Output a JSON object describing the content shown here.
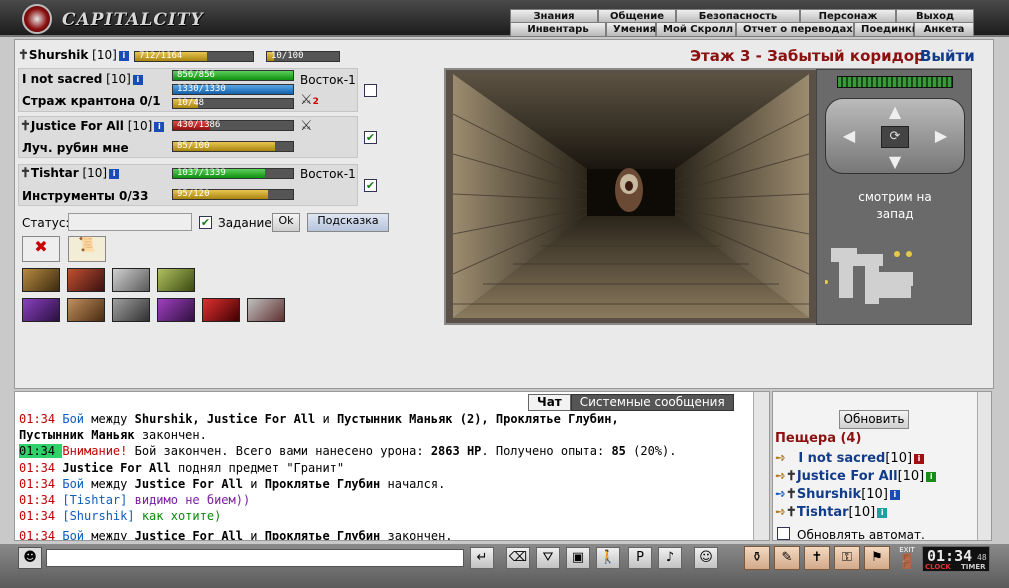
{
  "brand": "CAPITALCITY",
  "nav_top": [
    "Знания",
    "Общение",
    "Безопасность",
    "Персонаж",
    "Выход"
  ],
  "nav_bottom": [
    "Инвентарь",
    "Умения",
    "Мой Скролл",
    "Отчет о переводах",
    "Поединки",
    "Анкета"
  ],
  "location": {
    "title": "Этаж 3 - Забытый коридор",
    "exit": "Выйти"
  },
  "self": {
    "name": "Shurshik",
    "level": "[10]",
    "hp": "712/1164",
    "hp_frac": 0.61,
    "mana": "10/100",
    "mana_frac": 0.1
  },
  "party": [
    {
      "name": "I not sacred",
      "level": "[10]",
      "sub": "Страж крантона 0/1",
      "hp": "856/856",
      "hp_frac": 1.0,
      "mp": "1330/1330",
      "mp_frac": 1.0,
      "xp": "10/48",
      "xp_frac": 0.21,
      "dir": "Восток-1",
      "checked": false
    },
    {
      "name": "Justice For All",
      "level": "[10]",
      "sub": "Луч. рубин мне",
      "hp": "430/1386",
      "hp_frac": 0.31,
      "xp": "85/100",
      "xp_frac": 0.85,
      "dir": "",
      "checked": true
    },
    {
      "name": "Tishtar",
      "level": "[10]",
      "sub": "Инструменты 0/33",
      "hp": "1037/1339",
      "hp_frac": 0.77,
      "xp": "95/120",
      "xp_frac": 0.79,
      "dir": "Восток-1",
      "checked": true
    }
  ],
  "status": {
    "label": "Статус:",
    "value": "",
    "task_label": "Задание",
    "ok": "Ok",
    "hint": "Подсказка"
  },
  "compass": {
    "line1": "смотрим на",
    "line2": "запад"
  },
  "chat_tabs": [
    "Чат",
    "Системные сообщения"
  ],
  "chat": [
    {
      "time": "01:34",
      "parts": [
        {
          "c": "bl2",
          "t": "Бой"
        },
        {
          "c": "",
          "t": " между "
        },
        {
          "c": "b",
          "t": "Shurshik, Justice For All"
        },
        {
          "c": "",
          "t": "  и "
        },
        {
          "c": "b",
          "t": "Пустынник Маньяк (2), Проклятье Глубин,"
        }
      ]
    },
    {
      "time": "",
      "parts": [
        {
          "c": "b",
          "t": "Пустынник Маньяк"
        },
        {
          "c": "",
          "t": " закончен."
        }
      ]
    },
    {
      "time": "01:34",
      "hl": true,
      "parts": [
        {
          "c": "t",
          "t": "Внимание!"
        },
        {
          "c": "",
          "t": " Бой закончен. Всего вами нанесено урона: "
        },
        {
          "c": "b",
          "t": "2863 HP"
        },
        {
          "c": "",
          "t": ". Получено опыта: "
        },
        {
          "c": "b",
          "t": "85"
        },
        {
          "c": "",
          "t": " (20%)."
        }
      ]
    },
    {
      "time": "01:34",
      "parts": [
        {
          "c": "b",
          "t": "Justice For All"
        },
        {
          "c": "",
          "t": " поднял предмет \"Гранит\""
        }
      ]
    },
    {
      "time": "01:34",
      "parts": [
        {
          "c": "bl2",
          "t": "Бой"
        },
        {
          "c": "",
          "t": " между "
        },
        {
          "c": "b",
          "t": "Justice For All"
        },
        {
          "c": "",
          "t": " и "
        },
        {
          "c": "b",
          "t": "Проклятье Глубин"
        },
        {
          "c": "",
          "t": " начался."
        }
      ]
    },
    {
      "time": "01:34",
      "parts": [
        {
          "c": "bl2",
          "t": "[Tishtar]"
        },
        {
          "c": "pu",
          "t": " видимо не бием))"
        }
      ]
    },
    {
      "time": "01:34",
      "parts": [
        {
          "c": "bl2",
          "t": "[Shurshik]"
        },
        {
          "c": "gr",
          "t": " как хотите)"
        }
      ]
    },
    {
      "time": "01:34",
      "parts": [
        {
          "c": "bl2",
          "t": "Бой"
        },
        {
          "c": "",
          "t": " между "
        },
        {
          "c": "b",
          "t": "Justice For All"
        },
        {
          "c": "",
          "t": "  и "
        },
        {
          "c": "b",
          "t": "Проклятье Глубин"
        },
        {
          "c": "",
          "t": " закончен."
        }
      ]
    }
  ],
  "online": {
    "refresh": "Обновить",
    "room": "Пещера (4)",
    "users": [
      {
        "name": "I not sacred",
        "level": "[10]"
      },
      {
        "name": "Justice For All",
        "level": "[10]"
      },
      {
        "name": "Shurshik",
        "level": "[10]"
      },
      {
        "name": "Tishtar",
        "level": "[10]"
      }
    ],
    "auto": "Обновлять автомат."
  },
  "clock": {
    "time": "01:34",
    "sec": "48",
    "clock_lbl": "CLOCK",
    "timer_lbl": "TIMER",
    "exit_lbl": "EXIT"
  }
}
